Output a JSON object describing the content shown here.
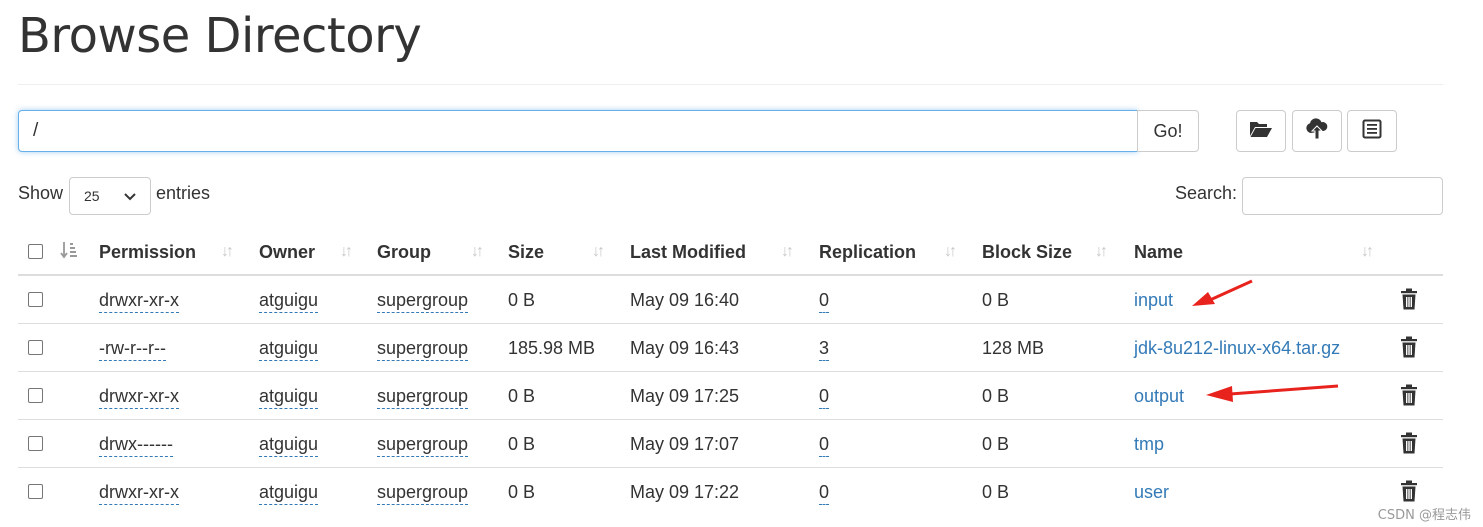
{
  "page": {
    "title": "Browse Directory"
  },
  "path_bar": {
    "value": "/",
    "go_label": "Go!"
  },
  "toolbar": {
    "create_dir_icon": "folder-open-icon",
    "upload_icon": "cloud-upload-icon",
    "cut_paste_icon": "list-alt-icon"
  },
  "length": {
    "show_label": "Show",
    "selected": "25",
    "entries_label": "entries"
  },
  "search": {
    "label": "Search:",
    "value": ""
  },
  "table": {
    "headers": {
      "permission": "Permission",
      "owner": "Owner",
      "group": "Group",
      "size": "Size",
      "last_modified": "Last Modified",
      "replication": "Replication",
      "block_size": "Block Size",
      "name": "Name"
    },
    "rows": [
      {
        "permission": "drwxr-xr-x",
        "owner": "atguigu",
        "group": "supergroup",
        "size": "0 B",
        "last_modified": "May 09 16:40",
        "replication": "0",
        "block_size": "0 B",
        "name": "input"
      },
      {
        "permission": "-rw-r--r--",
        "owner": "atguigu",
        "group": "supergroup",
        "size": "185.98 MB",
        "last_modified": "May 09 16:43",
        "replication": "3",
        "block_size": "128 MB",
        "name": "jdk-8u212-linux-x64.tar.gz"
      },
      {
        "permission": "drwxr-xr-x",
        "owner": "atguigu",
        "group": "supergroup",
        "size": "0 B",
        "last_modified": "May 09 17:25",
        "replication": "0",
        "block_size": "0 B",
        "name": "output"
      },
      {
        "permission": "drwx------",
        "owner": "atguigu",
        "group": "supergroup",
        "size": "0 B",
        "last_modified": "May 09 17:07",
        "replication": "0",
        "block_size": "0 B",
        "name": "tmp"
      },
      {
        "permission": "drwxr-xr-x",
        "owner": "atguigu",
        "group": "supergroup",
        "size": "0 B",
        "last_modified": "May 09 17:22",
        "replication": "0",
        "block_size": "0 B",
        "name": "user"
      }
    ]
  },
  "colors": {
    "link": "#337ab7",
    "annotation_arrow": "#e8231e",
    "focus_border": "#66afe9"
  },
  "watermark": "CSDN @程志伟"
}
